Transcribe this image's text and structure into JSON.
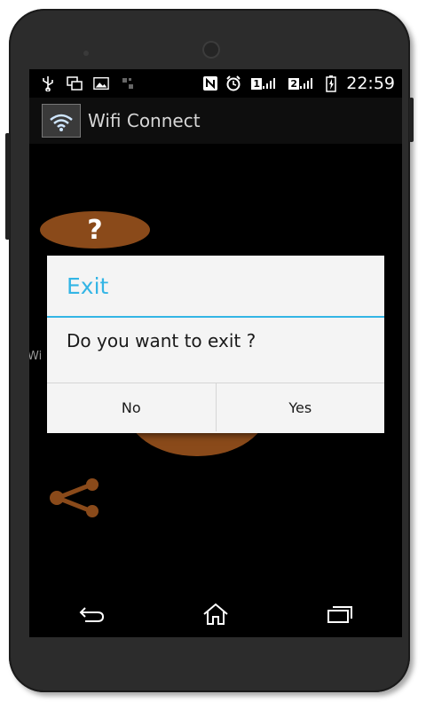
{
  "status_bar": {
    "time": "22:59",
    "sim1": "1",
    "sim2": "2",
    "icons": [
      "usb-icon",
      "screenshot-icon",
      "image-icon",
      "network-icon",
      "nfc-icon",
      "alarm-icon",
      "signal-icon",
      "battery-charging-icon"
    ]
  },
  "app": {
    "title": "Wifi Connect",
    "icon": "wifi-icon"
  },
  "background": {
    "help_icon": "?",
    "partial_text": "Wi",
    "share_icon": "share-icon"
  },
  "dialog": {
    "title": "Exit",
    "message": "Do you want to exit ?",
    "no_label": "No",
    "yes_label": "Yes"
  },
  "nav": {
    "back": "back-icon",
    "home": "home-icon",
    "recents": "recents-icon"
  },
  "colors": {
    "accent": "#33b5e5",
    "brown": "#8a4a1a",
    "dialog_bg": "#f4f4f4"
  }
}
